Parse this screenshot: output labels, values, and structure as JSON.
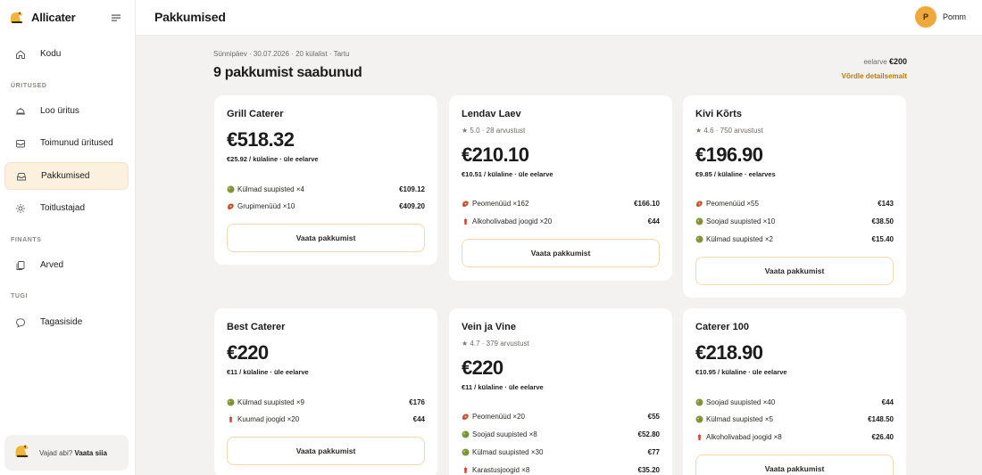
{
  "app": {
    "name": "Allicater"
  },
  "sidebar": {
    "items": [
      {
        "label": "Kodu",
        "icon": "home-icon"
      },
      {
        "label": "Loo üritus",
        "icon": "serving-dish-icon"
      },
      {
        "label": "Toimunud üritused",
        "icon": "inbox-icon"
      },
      {
        "label": "Pakkumised",
        "icon": "offers-tray-icon"
      },
      {
        "label": "Toitlustajad",
        "icon": "chef-icon"
      },
      {
        "label": "Arved",
        "icon": "documents-icon"
      },
      {
        "label": "Tagasiside",
        "icon": "chat-bubble-icon"
      }
    ],
    "sections": {
      "events": "ÜRITUSED",
      "finance": "FINANTS",
      "support": "TUGI"
    },
    "help": {
      "text": "Vajad abi?",
      "link": "Vaata siia"
    }
  },
  "topbar": {
    "title": "Pakkumised",
    "user": {
      "initial": "P",
      "name": "Pomm"
    }
  },
  "event": {
    "breadcrumb": "Sünnipäev · 30.07.2026 · 20 külalist · Tartu",
    "offers_title": "9 pakkumist saabunud",
    "budget_label": "eelarve",
    "budget_value": "€200",
    "compare_link": "Võrdle detailsemalt"
  },
  "button_label": "Vaata pakkumist",
  "colors": {
    "accent": "#efa93a",
    "link": "#b77a10",
    "active_bg": "#fbf1de",
    "button_border": "#f0d9ad"
  },
  "offers": [
    {
      "name": "Grill Caterer",
      "rating": "",
      "price": "€518.32",
      "per_guest": "€25.92 / külaline · üle eelarve",
      "items": [
        {
          "icon": "salad-icon",
          "label": "Külmad suupisted ×4",
          "amount": "€109.12"
        },
        {
          "icon": "meat-icon",
          "label": "Grupimenüüd ×10",
          "amount": "€409.20"
        }
      ]
    },
    {
      "name": "Lendav Laev",
      "rating": "5.0 · 28 arvustust",
      "price": "€210.10",
      "per_guest": "€10.51 / külaline · üle eelarve",
      "items": [
        {
          "icon": "meat-icon",
          "label": "Peomenüüd ×162",
          "amount": "€166.10"
        },
        {
          "icon": "drink-icon",
          "label": "Alkoholivabad joogid ×20",
          "amount": "€44"
        }
      ]
    },
    {
      "name": "Kivi Kõrts",
      "rating": "4.6 · 750 arvustust",
      "price": "€196.90",
      "per_guest": "€9.85 / külaline · eelarves",
      "items": [
        {
          "icon": "meat-icon",
          "label": "Peomenüüd ×55",
          "amount": "€143"
        },
        {
          "icon": "salad-icon",
          "label": "Soojad suupisted ×10",
          "amount": "€38.50"
        },
        {
          "icon": "salad-icon",
          "label": "Külmad suupisted ×2",
          "amount": "€15.40"
        }
      ]
    },
    {
      "name": "Best Caterer",
      "rating": "",
      "price": "€220",
      "per_guest": "€11 / külaline · üle eelarve",
      "items": [
        {
          "icon": "salad-icon",
          "label": "Külmad suupisted ×9",
          "amount": "€176"
        },
        {
          "icon": "drink-icon",
          "label": "Kuumad joogid ×20",
          "amount": "€44"
        }
      ]
    },
    {
      "name": "Vein ja Vine",
      "rating": "4.7 · 379 arvustust",
      "price": "€220",
      "per_guest": "€11 / külaline · üle eelarve",
      "items": [
        {
          "icon": "meat-icon",
          "label": "Peomenüüd ×20",
          "amount": "€55"
        },
        {
          "icon": "salad-icon",
          "label": "Soojad suupisted ×8",
          "amount": "€52.80"
        },
        {
          "icon": "salad-icon",
          "label": "Külmad suupisted ×30",
          "amount": "€77"
        },
        {
          "icon": "drink-icon",
          "label": "Karastusjoogid ×8",
          "amount": "€35.20"
        }
      ]
    },
    {
      "name": "Caterer 100",
      "rating": "",
      "price": "€218.90",
      "per_guest": "€10.95 / külaline · üle eelarve",
      "items": [
        {
          "icon": "salad-icon",
          "label": "Soojad suupisted ×40",
          "amount": "€44"
        },
        {
          "icon": "salad-icon",
          "label": "Külmad suupisted ×5",
          "amount": "€148.50"
        },
        {
          "icon": "drink-icon",
          "label": "Alkoholivabad joogid ×8",
          "amount": "€26.40"
        }
      ]
    }
  ]
}
